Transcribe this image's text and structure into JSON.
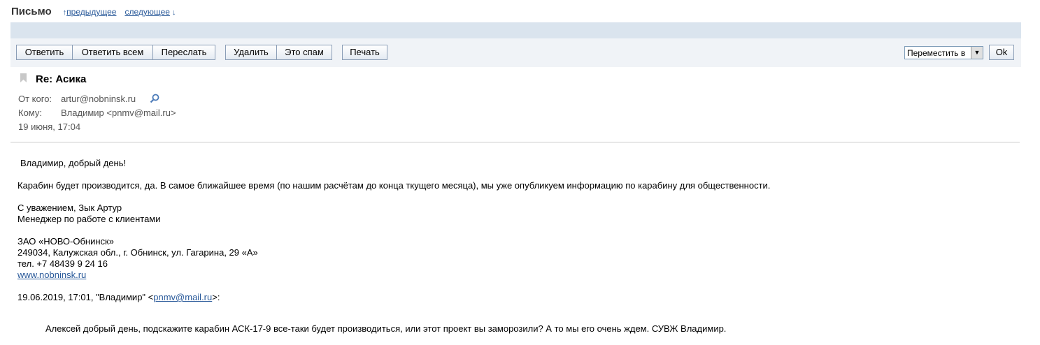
{
  "header": {
    "title": "Письмо",
    "prev_label": "предыдущее",
    "next_label": "следующее",
    "prev_icon": "arrow-up-icon",
    "next_icon": "arrow-down-icon"
  },
  "toolbar": {
    "reply": "Ответить",
    "reply_all": "Ответить всем",
    "forward": "Переслать",
    "delete": "Удалить",
    "spam": "Это спам",
    "print": "Печать",
    "move_select": "Переместить в",
    "ok": "Ok"
  },
  "message": {
    "subject": "Re: Асика",
    "from_label": "От кого:",
    "from_value": "artur@nobninsk.ru",
    "to_label": "Кому:",
    "to_value": "Владимир <pnmv@mail.ru>",
    "date": "19 июня, 17:04",
    "body": {
      "greeting": "Владимир, добрый день!",
      "text": "Карабин будет производится, да. В самое ближайшее время (по нашим расчётам до конца ткущего месяца), мы уже опубликуем информацию по карабину для общественности.",
      "regards": "С уважением, Зык Артур",
      "position": "Менеджер по работе с клиентами",
      "company": "ЗАО «НОВО-Обнинск»",
      "address": "249034, Калужская обл., г. Обнинск, ул. Гагарина, 29 «А»",
      "phone": "тел. +7 48439 9 24 16",
      "website": "www.nobninsk.ru",
      "quote_header_prefix": "19.06.2019, 17:01, \"Владимир\" <",
      "quote_header_email": "pnmv@mail.ru",
      "quote_header_suffix": ">:",
      "quote_text": "Алексей добрый день, подскажите карабин АСК-17-9 все-таки будет производиться, или этот проект вы заморозили? А то мы его очень ждем. СУВЖ Владимир."
    }
  },
  "colors": {
    "link": "#2a5a9a",
    "toolbar_band": "#dae4ee",
    "toolbar_bg": "#f0f3f7"
  }
}
